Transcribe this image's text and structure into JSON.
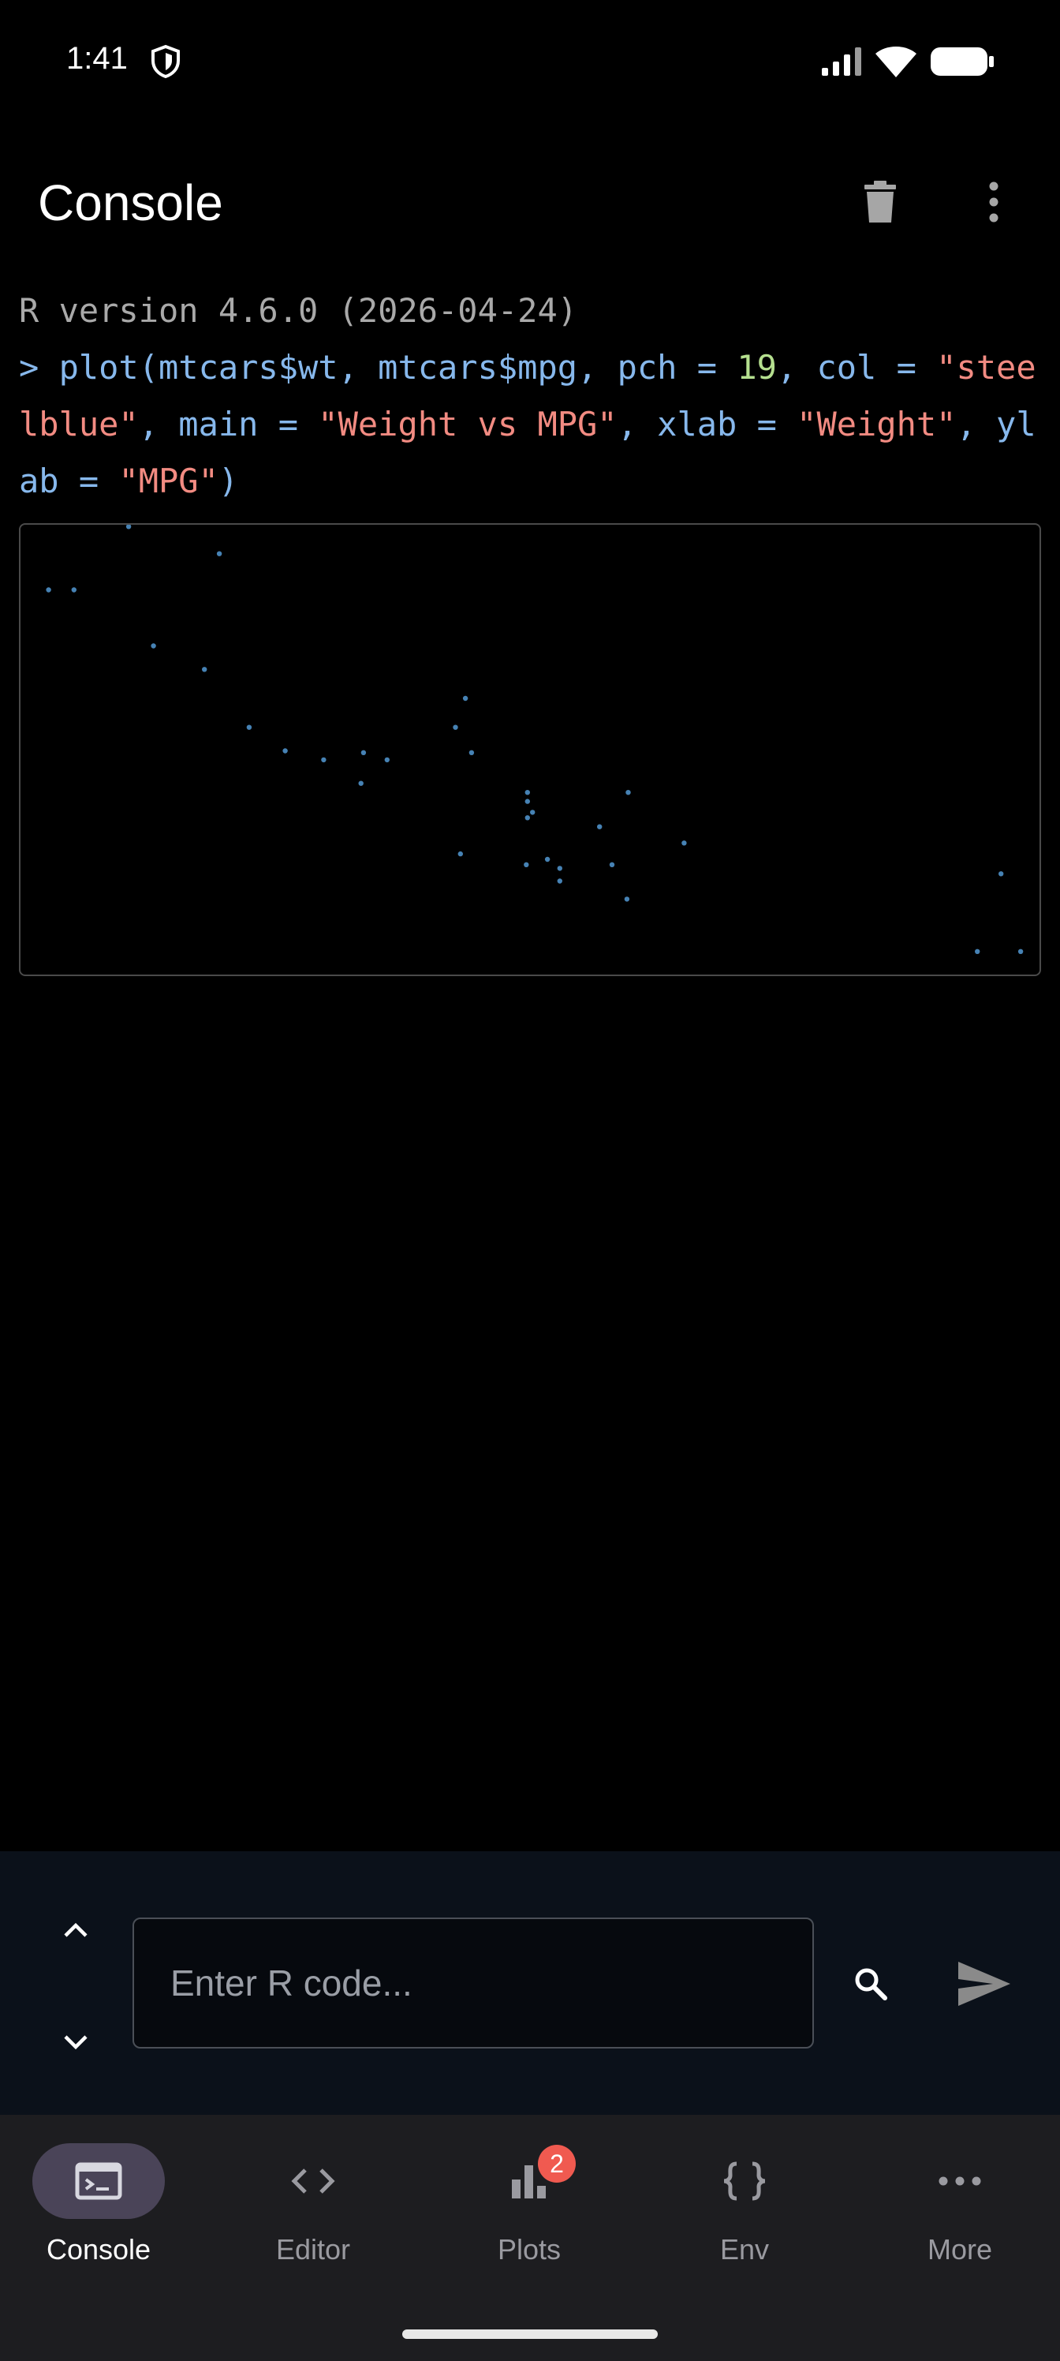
{
  "status_bar": {
    "time": "1:41",
    "icons": [
      "shield-icon",
      "signal-icon",
      "wifi-icon",
      "battery-icon"
    ]
  },
  "header": {
    "title": "Console",
    "actions": [
      "trash-icon",
      "more-vert-icon"
    ]
  },
  "console": {
    "version_line": "R version 4.6.0 (2026-04-24)",
    "prompt": "> ",
    "command_tokens": [
      {
        "t": "plain",
        "v": "plot(mtcars$wt, mtcars$mpg, pch = "
      },
      {
        "t": "num",
        "v": "19"
      },
      {
        "t": "plain",
        "v": ", col = "
      },
      {
        "t": "str",
        "v": "\"steelblue\""
      },
      {
        "t": "plain",
        "v": ", main = "
      },
      {
        "t": "str",
        "v": "\"Weight vs MPG\""
      },
      {
        "t": "plain",
        "v": ", xlab = "
      },
      {
        "t": "str",
        "v": "\"Weight\""
      },
      {
        "t": "plain",
        "v": ", ylab = "
      },
      {
        "t": "str",
        "v": "\"MPG\""
      },
      {
        "t": "plain",
        "v": ")"
      }
    ],
    "colors": {
      "prompt": "#87b8ec",
      "number": "#b5e08f",
      "string": "#f28b82",
      "version": "#a9a9a9"
    }
  },
  "chart_data": {
    "type": "scatter",
    "point_color": "#4682b4",
    "xlim": [
      1.4,
      5.5
    ],
    "ylim": [
      10,
      34
    ],
    "x": [
      2.62,
      2.875,
      2.32,
      3.215,
      3.44,
      3.46,
      3.57,
      3.19,
      3.15,
      3.44,
      3.44,
      4.07,
      3.73,
      3.78,
      5.25,
      5.424,
      5.345,
      2.2,
      1.615,
      1.835,
      2.465,
      3.52,
      3.435,
      3.84,
      3.845,
      1.935,
      2.14,
      1.513,
      3.17,
      2.77,
      3.57,
      2.78
    ],
    "y": [
      21.0,
      21.0,
      22.8,
      21.4,
      18.7,
      18.1,
      14.3,
      24.4,
      22.8,
      19.2,
      17.8,
      16.4,
      17.3,
      15.2,
      10.4,
      10.4,
      14.7,
      32.4,
      30.4,
      33.9,
      21.5,
      15.5,
      15.2,
      13.3,
      19.2,
      27.3,
      26.0,
      30.4,
      15.8,
      19.7,
      15.0,
      21.4
    ]
  },
  "input": {
    "placeholder": "Enter R code...",
    "value": ""
  },
  "bottom_nav": {
    "items": [
      {
        "label": "Console",
        "icon": "terminal-icon",
        "active": true
      },
      {
        "label": "Editor",
        "icon": "code-icon",
        "active": false
      },
      {
        "label": "Plots",
        "icon": "bar-chart-icon",
        "active": false,
        "badge": "2"
      },
      {
        "label": "Env",
        "icon": "braces-icon",
        "active": false
      },
      {
        "label": "More",
        "icon": "more-horiz-icon",
        "active": false
      }
    ]
  }
}
